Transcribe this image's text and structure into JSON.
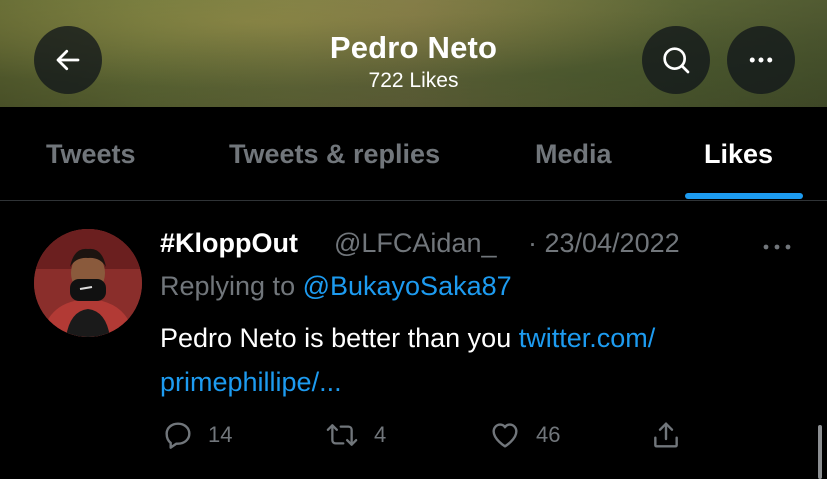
{
  "header": {
    "title": "Pedro Neto",
    "subtitle": "722 Likes",
    "back_icon": "arrow-left-icon",
    "search_icon": "search-icon",
    "more_icon": "more-horizontal-icon"
  },
  "tabs": [
    {
      "label": "Tweets",
      "active": false
    },
    {
      "label": "Tweets & replies",
      "active": false
    },
    {
      "label": "Media",
      "active": false
    },
    {
      "label": "Likes",
      "active": true
    }
  ],
  "tweet": {
    "display_name": "#KloppOut",
    "handle": "@LFCAidan_",
    "date": "· 23/04/2022",
    "replying_prefix": "Replying to ",
    "replying_to": "@BukayoSaka87",
    "text": "Pedro Neto is better than you ",
    "link_line1": "twitter.com/",
    "link_line2": "primephillipe/...",
    "replies": "14",
    "retweets": "4",
    "likes": "46"
  },
  "colors": {
    "accent": "#1d9bf0",
    "muted": "#71767b",
    "background": "#000000"
  }
}
